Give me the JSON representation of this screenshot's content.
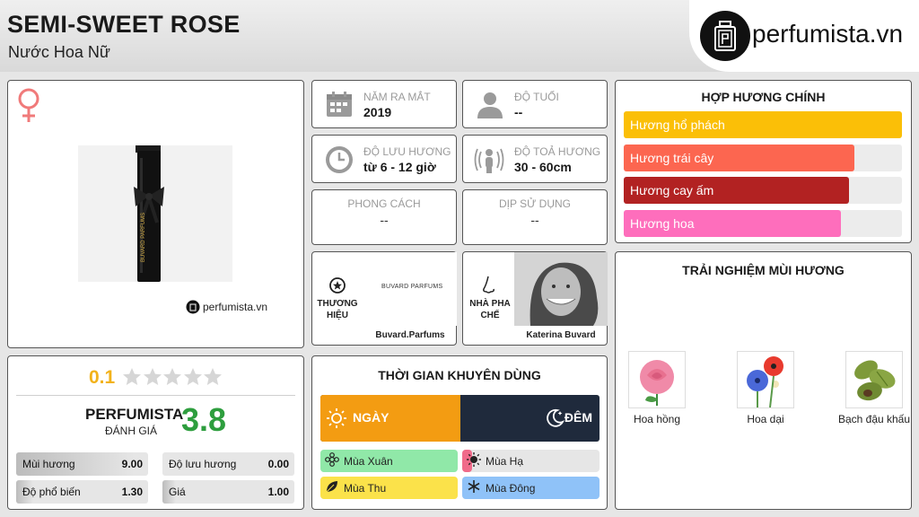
{
  "header": {
    "title": "SEMI-SWEET ROSE",
    "subtitle": "Nước Hoa Nữ",
    "logo_text": "perfumista.vn"
  },
  "product": {
    "gender_icon": "venus-icon",
    "watermark": "perfumista.vn",
    "bottle_brand_text": "BUVARD PARFUMS"
  },
  "info": {
    "release_label": "NĂM RA MẮT",
    "release_value": "2019",
    "age_label": "ĐỘ TUỔI",
    "age_value": "--",
    "longevity_label": "ĐỘ LƯU HƯƠNG",
    "longevity_value": "từ 6 - 12 giờ",
    "sillage_label": "ĐỘ TOẢ HƯƠNG",
    "sillage_value": "30 - 60cm",
    "style_label": "PHONG CÁCH",
    "style_value": "--",
    "occasion_label": "DỊP SỬ DỤNG",
    "occasion_value": "--"
  },
  "brand": {
    "label": "THƯƠNG HIỆU",
    "logo_text": "BUVARD PARFUMS",
    "name": "Buvard.Parfums"
  },
  "perfumer": {
    "label": "NHÀ PHA CHẾ",
    "name": "Katerina Buvard"
  },
  "accords": {
    "title": "HỢP HƯƠNG CHÍNH",
    "items": [
      {
        "label": "Hương hổ phách",
        "color": "#fbbf07",
        "fraction": 1.0
      },
      {
        "label": "Hương trái cây",
        "color": "#fc6650",
        "fraction": 0.83
      },
      {
        "label": "Hương cay ấm",
        "color": "#b22222",
        "fraction": 0.81
      },
      {
        "label": "Hương hoa",
        "color": "#fe6ebc",
        "fraction": 0.78
      }
    ]
  },
  "rating": {
    "user_score": "0.1",
    "stars_filled": 0,
    "stars_total": 5,
    "brand_label": "PERFUMISTA",
    "sub_label": "ĐÁNH GIÁ",
    "score": "3.8",
    "rows": [
      {
        "label": "Mùi hương",
        "value": "9.00",
        "fraction": 0.9
      },
      {
        "label": "Độ lưu hương",
        "value": "0.00",
        "fraction": 0.0
      },
      {
        "label": "Độ phổ biến",
        "value": "1.30",
        "fraction": 0.13
      },
      {
        "label": "Giá",
        "value": "1.00",
        "fraction": 0.1
      }
    ]
  },
  "time": {
    "title": "THỜI GIAN KHUYÊN DÙNG",
    "day_label": "NGÀY",
    "night_label": "ĐÊM",
    "day_fraction": 0.5,
    "seasons": [
      {
        "label": "Mùa Xuân",
        "color": "#90e8a8",
        "fraction": 1.0,
        "icon": "flower-icon"
      },
      {
        "label": "Mùa Hạ",
        "color": "#f06a8a",
        "fraction": 0.07,
        "icon": "sun-icon"
      },
      {
        "label": "Mùa Thu",
        "color": "#fbe24a",
        "fraction": 1.0,
        "icon": "leaf-icon"
      },
      {
        "label": "Mùa Đông",
        "color": "#8fc2f8",
        "fraction": 1.0,
        "icon": "snowflake-icon"
      }
    ]
  },
  "notes": {
    "title": "TRẢI NGHIỆM MÙI HƯƠNG",
    "items": [
      {
        "label": "Hoa hồng",
        "icon": "rose-image"
      },
      {
        "label": "Hoa dại",
        "icon": "wildflowers-image"
      },
      {
        "label": "Bạch đậu khấu",
        "icon": "cardamom-image"
      }
    ]
  }
}
